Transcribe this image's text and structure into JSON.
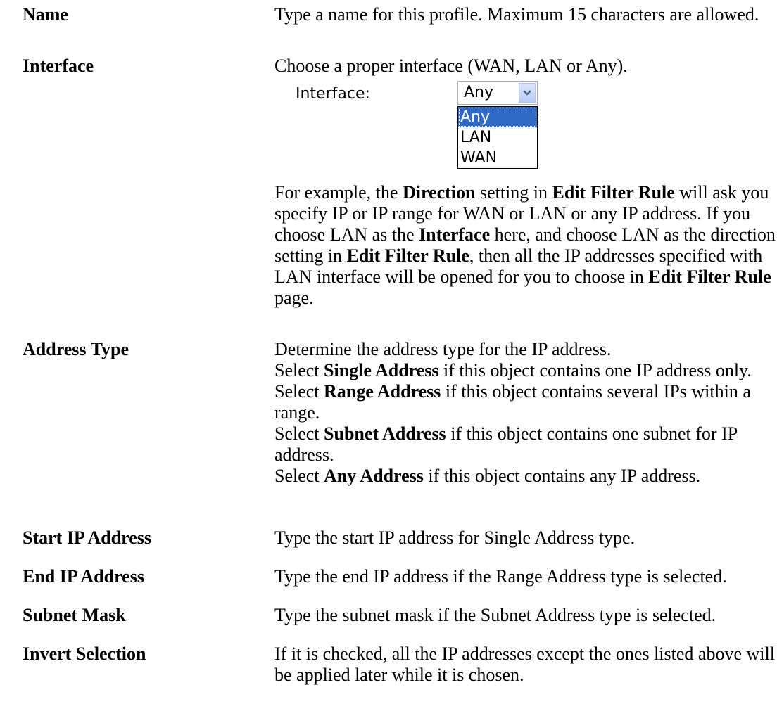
{
  "rows": [
    {
      "term": "Name",
      "desc": "Type a name for this profile. Maximum 15 characters are allowed."
    },
    {
      "term": "Interface",
      "desc": "Choose a proper interface (WAN, LAN or Any).",
      "widget": {
        "label": "Interface:",
        "selected": "Any",
        "options": [
          "Any",
          "LAN",
          "WAN"
        ]
      },
      "example": {
        "t1": "For example, the ",
        "b1": "Direction",
        "t2": " setting in ",
        "b2": "Edit Filter Rule",
        "t3": " will ask you specify IP or IP range for WAN or LAN or any IP address. If you choose LAN as the ",
        "b3": "Interface",
        "t4": " here, and choose LAN as the direction setting in ",
        "b4": "Edit Filter Rule",
        "t5": ", then all the IP addresses specified with LAN interface will be opened for you to choose in ",
        "b5": "Edit Filter Rule",
        "t6": " page."
      }
    },
    {
      "term": "Address Type",
      "desc": "Determine the address type for the IP address.",
      "lines": [
        {
          "pre": "Select ",
          "bold": "Single Address",
          "post": " if this object contains one IP address only."
        },
        {
          "pre": "Select ",
          "bold": "Range Address",
          "post": " if this object contains several IPs within a range."
        },
        {
          "pre": "Select ",
          "bold": "Subnet Address",
          "post": " if this object contains one subnet for IP address."
        },
        {
          "pre": "Select ",
          "bold": "Any Address",
          "post": " if this object contains any IP address."
        }
      ]
    },
    {
      "term": "Start IP Address",
      "desc": "Type the start IP address for Single Address type."
    },
    {
      "term": "End IP Address",
      "desc": "Type the end IP address if the Range Address type is selected."
    },
    {
      "term": "Subnet Mask",
      "desc": "Type the subnet mask if the Subnet Address type is selected."
    },
    {
      "term": "Invert Selection",
      "desc": "If it is checked, all the IP addresses except the ones listed above will be applied later while it is chosen."
    }
  ],
  "colors": {
    "select_highlight": "#3169c6",
    "select_button": "#b9cdf6"
  }
}
